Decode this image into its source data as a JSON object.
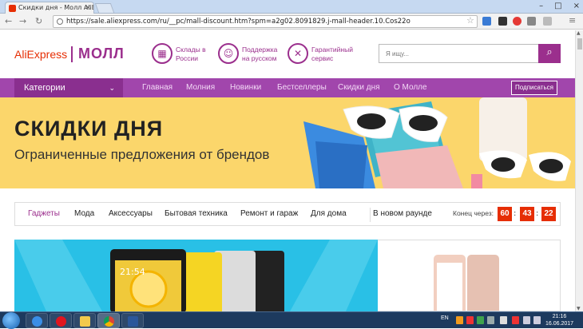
{
  "browser": {
    "tab_title": "Скидки дня - Молл AliEx",
    "url": "https://sale.aliexpress.com/ru/__pc/mall-discount.htm?spm=a2g02.8091829.j-mall-header.10.Cos22o"
  },
  "header": {
    "logo_brand": "AliExpress",
    "logo_mall": "МОЛЛ",
    "features": [
      {
        "line1": "Склады в",
        "line2": "России",
        "icon": "warehouse-icon"
      },
      {
        "line1": "Поддержка",
        "line2": "на русском",
        "icon": "support-agent-icon"
      },
      {
        "line1": "Гарантийный",
        "line2": "сервис",
        "icon": "tools-icon"
      }
    ],
    "search_placeholder": "Я ищу..."
  },
  "nav": {
    "categories": "Категории",
    "links": [
      "Главная",
      "Молния",
      "Новинки",
      "Бестселлеры",
      "Скидки дня",
      "О Молле"
    ],
    "subscribe": "Подписаться"
  },
  "banner": {
    "title": "СКИДКИ ДНЯ",
    "subtitle": "Ограниченные предложения от брендов"
  },
  "category_tabs": {
    "items": [
      "Гаджеты",
      "Мода",
      "Аксессуары",
      "Бытовая техника",
      "Ремонт и гараж",
      "Для дома",
      "В новом раунде"
    ],
    "timer_label": "Конец через:",
    "hours": "60",
    "minutes": "43",
    "seconds": "22"
  },
  "taskbar": {
    "lang": "EN",
    "time": "21:16",
    "date": "16.06.2017"
  },
  "colors": {
    "brand_purple": "#9b2f8d",
    "nav_purple": "#a146ac",
    "accent_red": "#e62e04",
    "banner_yellow": "#fbd66b"
  }
}
